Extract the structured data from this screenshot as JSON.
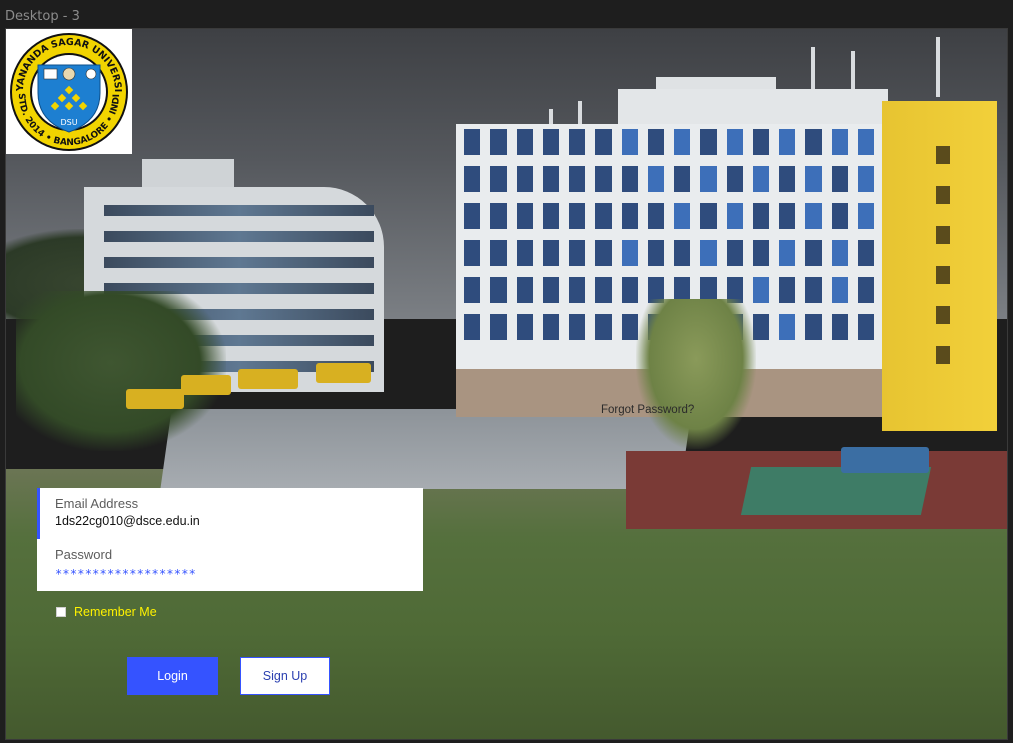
{
  "frame": {
    "title": "Desktop - 3"
  },
  "logo": {
    "ring_text_top": "DAYANANDA SAGAR UNIVERSITY",
    "ring_text_bottom": "ESTD. 2014 • BANGALORE • INDIA",
    "shield_text": "DSU",
    "colors": {
      "ring": "#f2d400",
      "shield": "#1d7fd1",
      "text": "#111111"
    }
  },
  "form": {
    "email": {
      "label": "Email Address",
      "value": "1ds22cg010@dsce.edu.in"
    },
    "password": {
      "label": "Password",
      "masked_value": "*******************"
    },
    "remember_label": "Remember Me",
    "forgot_label": "Forgot Password?",
    "login_label": "Login",
    "signup_label": "Sign Up"
  },
  "colors": {
    "accent": "#3553ff",
    "remember_text": "#fff200"
  }
}
